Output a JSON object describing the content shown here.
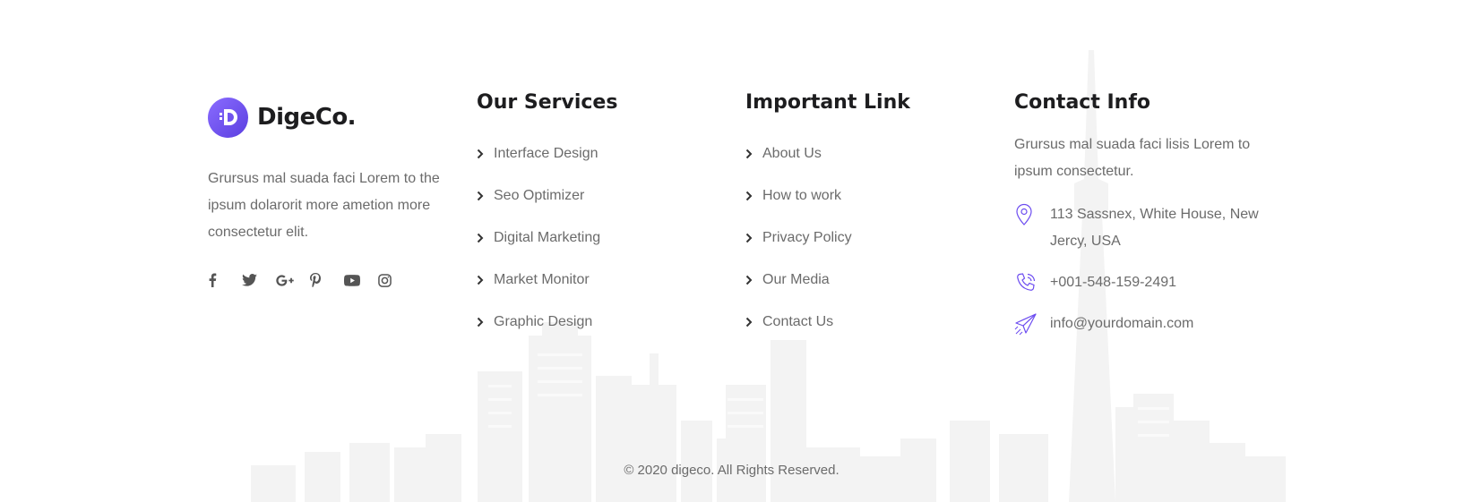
{
  "brand": {
    "logo_letter": "D",
    "name": "DigeCo.",
    "accent_color": "#6c4cf0"
  },
  "about": {
    "text": "Grursus mal suada faci Lorem to the ipsum dolarorit more ametion more consectetur elit.",
    "socials": [
      {
        "icon": "facebook-icon"
      },
      {
        "icon": "twitter-icon"
      },
      {
        "icon": "google-plus-icon"
      },
      {
        "icon": "pinterest-icon"
      },
      {
        "icon": "youtube-icon"
      },
      {
        "icon": "instagram-icon"
      }
    ]
  },
  "services": {
    "title": "Our Services",
    "items": [
      "Interface Design",
      "Seo Optimizer",
      "Digital Marketing",
      "Market Monitor",
      "Graphic Design"
    ]
  },
  "links": {
    "title": "Important Link",
    "items": [
      "About Us",
      "How to work",
      "Privacy Policy",
      "Our Media",
      "Contact Us"
    ]
  },
  "contact": {
    "title": "Contact Info",
    "text": "Grursus mal suada faci lisis Lorem to ipsum consectetur.",
    "address": "113 Sassnex, White House, New Jercy, USA",
    "phone": "+001-548-159-2491",
    "email": "info@yourdomain.com"
  },
  "copyright": "© 2020 digeco. All Rights Reserved."
}
